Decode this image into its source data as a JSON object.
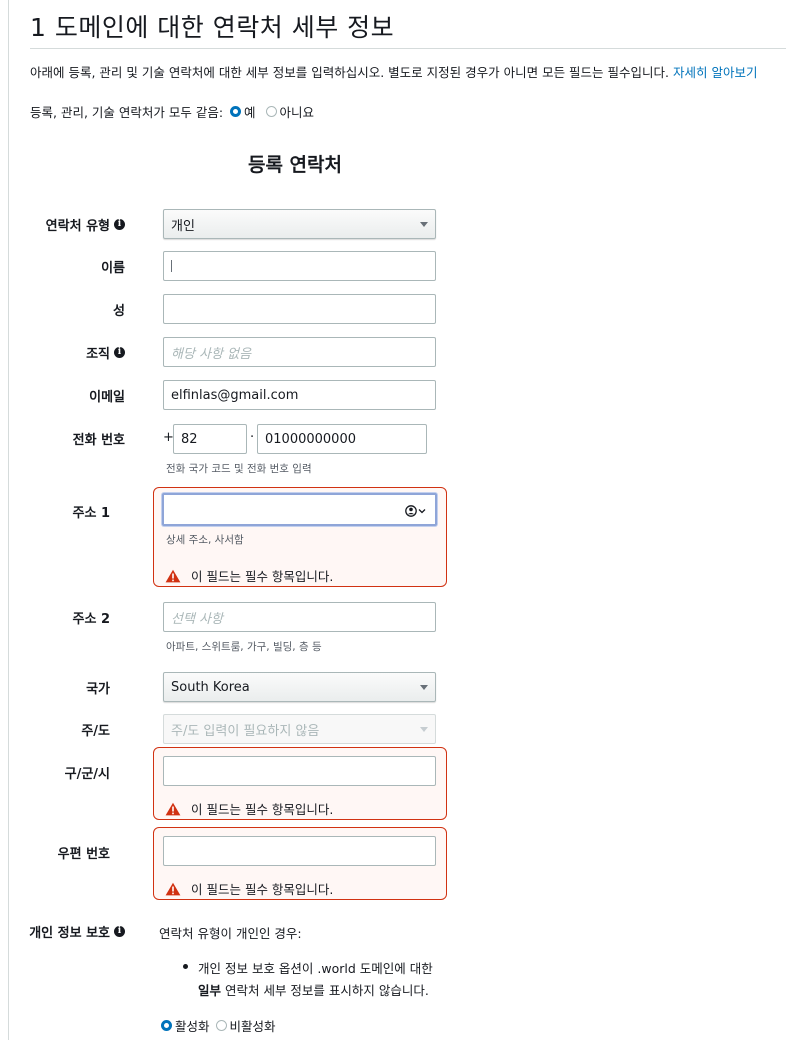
{
  "header": {
    "title": "1 도메인에 대한 연락처 세부 정보",
    "intro": "아래에 등록, 관리 및 기술 연락처에 대한 세부 정보를 입력하십시오. 별도로 지정된 경우가 아니면 모든 필드는 필수입니다. ",
    "learn_more": "자세히 알아보기"
  },
  "same_contacts": {
    "label": "등록, 관리, 기술 연락처가 모두 같음:",
    "yes": "예",
    "no": "아니요",
    "selected": "yes"
  },
  "section_title": "등록 연락처",
  "form": {
    "contact_type": {
      "label": "연락처 유형",
      "value": "개인"
    },
    "first_name": {
      "label": "이름",
      "value": ""
    },
    "last_name": {
      "label": "성",
      "value": ""
    },
    "organization": {
      "label": "조직",
      "placeholder": "해당 사항 없음"
    },
    "email": {
      "label": "이메일",
      "value": "elfinlas@gmail.com"
    },
    "phone": {
      "label": "전화 번호",
      "plus": "+",
      "country_code": "82",
      "separator": "·",
      "number": "01000000000",
      "hint": "전화 국가 코드 및 전화 번호 입력"
    },
    "address1": {
      "label": "주소 1",
      "value": "",
      "hint": "상세 주소, 사서함",
      "error": "이 필드는 필수 항목입니다."
    },
    "address2": {
      "label": "주소 2",
      "placeholder": "선택 사항",
      "hint": "아파트, 스위트룸, 가구, 빌딩, 층 등"
    },
    "country": {
      "label": "국가",
      "value": "South Korea"
    },
    "state": {
      "label": "주/도",
      "value": "주/도 입력이 필요하지 않음"
    },
    "city": {
      "label": "구/군/시",
      "value": "",
      "error": "이 필드는 필수 항목입니다."
    },
    "postal": {
      "label": "우편 번호",
      "value": "",
      "error": "이 필드는 필수 항목입니다."
    }
  },
  "privacy": {
    "label": "개인 정보 보호",
    "intro": "연락처 유형이 개인인 경우:",
    "bullet_line1": "개인 정보 보호 옵션이 .world 도메인에 대한",
    "bullet_bold": "일부",
    "bullet_line2": " 연락처 세부 정보를 표시하지 않습니다.",
    "enable": "활성화",
    "disable": "비활성화",
    "selected": "enable"
  },
  "colors": {
    "link": "#0073bb",
    "error": "#d13212",
    "focus": "#8fa5d8"
  },
  "icons": {
    "info": "info-icon",
    "warning": "warning-icon",
    "autofill": "contact-autofill-icon",
    "dropdown": "caret-down-icon"
  }
}
